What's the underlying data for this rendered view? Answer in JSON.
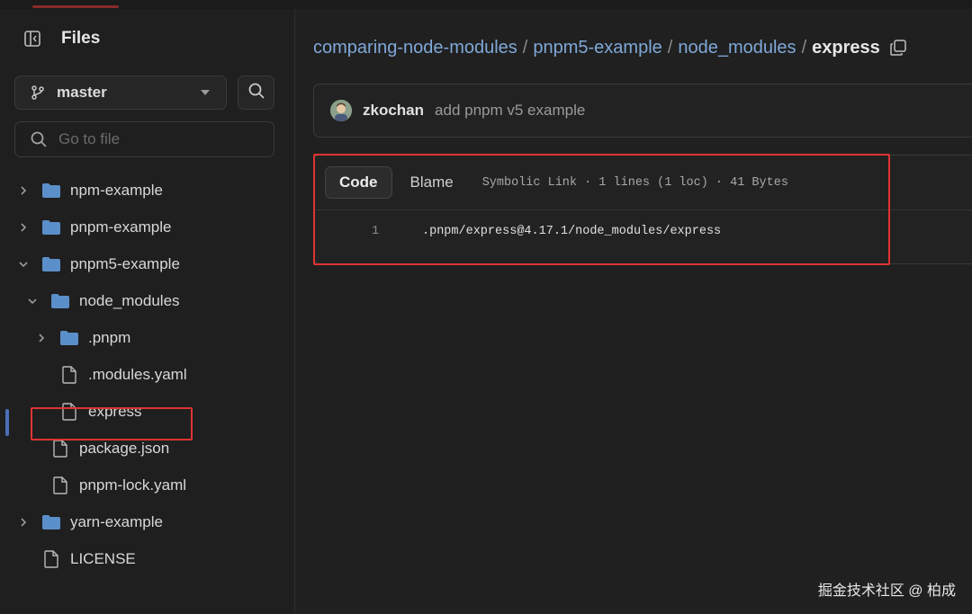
{
  "sidebar": {
    "title": "Files",
    "branch": "master",
    "goto_placeholder": "Go to file",
    "tree": [
      {
        "label": "npm-example",
        "type": "folder",
        "expanded": false,
        "depth": 0
      },
      {
        "label": "pnpm-example",
        "type": "folder",
        "expanded": false,
        "depth": 0
      },
      {
        "label": "pnpm5-example",
        "type": "folder",
        "expanded": true,
        "depth": 0
      },
      {
        "label": "node_modules",
        "type": "folder",
        "expanded": true,
        "depth": 1
      },
      {
        "label": ".pnpm",
        "type": "folder",
        "expanded": false,
        "depth": 2
      },
      {
        "label": ".modules.yaml",
        "type": "file",
        "depth": 2
      },
      {
        "label": "express",
        "type": "file",
        "depth": 2,
        "selected": true
      },
      {
        "label": "package.json",
        "type": "file",
        "depth": 1
      },
      {
        "label": "pnpm-lock.yaml",
        "type": "file",
        "depth": 1
      },
      {
        "label": "yarn-example",
        "type": "folder",
        "expanded": false,
        "depth": 0
      },
      {
        "label": "LICENSE",
        "type": "file",
        "depth": 0
      }
    ]
  },
  "breadcrumb": {
    "parts": [
      "comparing-node-modules",
      "pnpm5-example",
      "node_modules"
    ],
    "separator": "/",
    "current": "express"
  },
  "commit": {
    "author": "zkochan",
    "message": "add pnpm v5 example"
  },
  "file": {
    "tabs": {
      "code": "Code",
      "blame": "Blame"
    },
    "meta": "Symbolic Link · 1 lines (1 loc) · 41 Bytes",
    "line_number": "1",
    "line_text": ".pnpm/express@4.17.1/node_modules/express"
  },
  "watermark": "掘金技术社区 @ 柏成",
  "colors": {
    "folder": "#5b8fc9",
    "link": "#7fa8d8",
    "highlight": "#e03333",
    "active_indicator": "#4a6fb8"
  }
}
